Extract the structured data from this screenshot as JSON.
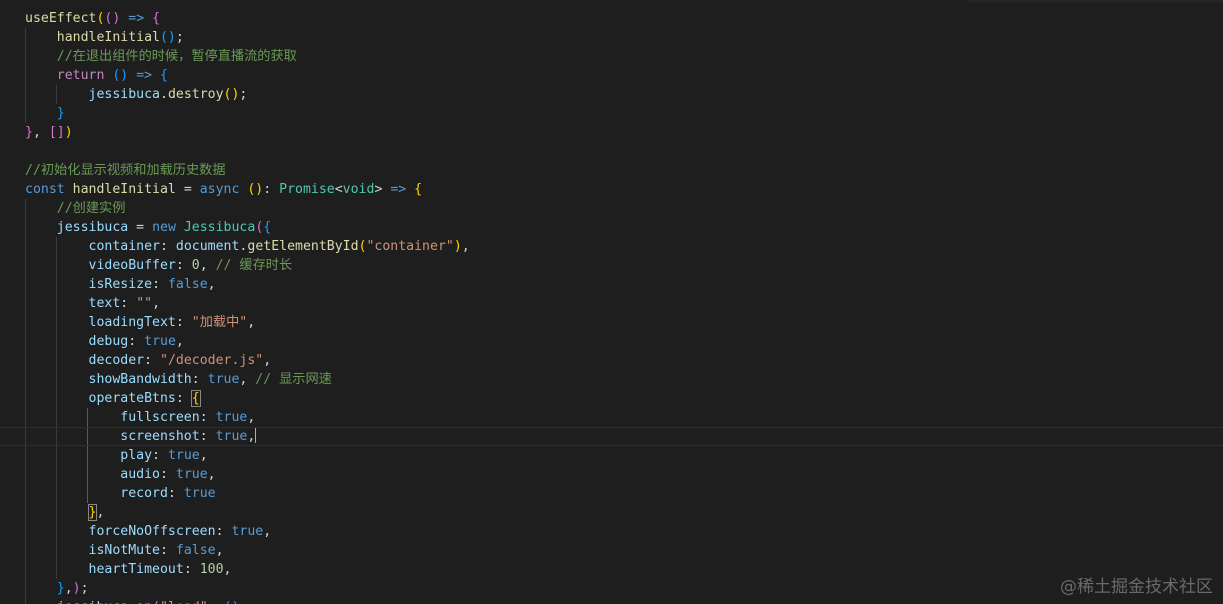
{
  "editor": {
    "lines": [
      [
        [
          "f",
          "useEffect"
        ],
        [
          "b1",
          "("
        ],
        [
          "b2",
          "()"
        ],
        [
          "p",
          " "
        ],
        [
          "k",
          "=>"
        ],
        [
          "p",
          " "
        ],
        [
          "b2",
          "{"
        ]
      ],
      [
        [
          "p",
          "    "
        ],
        [
          "f",
          "handleInitial"
        ],
        [
          "b3",
          "()"
        ],
        [
          "p",
          ";"
        ]
      ],
      [
        [
          "p",
          "    "
        ],
        [
          "m",
          "//在退出组件的时候，暂停直播流的获取"
        ]
      ],
      [
        [
          "p",
          "    "
        ],
        [
          "c",
          "return"
        ],
        [
          "p",
          " "
        ],
        [
          "b3",
          "()"
        ],
        [
          "p",
          " "
        ],
        [
          "k",
          "=>"
        ],
        [
          "p",
          " "
        ],
        [
          "b3",
          "{"
        ]
      ],
      [
        [
          "p",
          "        "
        ],
        [
          "v",
          "jessibuca"
        ],
        [
          "p",
          "."
        ],
        [
          "f",
          "destroy"
        ],
        [
          "b1",
          "()"
        ],
        [
          "p",
          ";"
        ]
      ],
      [
        [
          "p",
          "    "
        ],
        [
          "b3",
          "}"
        ]
      ],
      [
        [
          "b2",
          "}"
        ],
        [
          "p",
          ", "
        ],
        [
          "b2",
          "[]"
        ],
        [
          "b1",
          ")"
        ]
      ],
      [],
      [
        [
          "m",
          "//初始化显示视频和加载历史数据"
        ]
      ],
      [
        [
          "k",
          "const"
        ],
        [
          "p",
          " "
        ],
        [
          "f",
          "handleInitial"
        ],
        [
          "p",
          " = "
        ],
        [
          "k",
          "async"
        ],
        [
          "p",
          " "
        ],
        [
          "b1",
          "()"
        ],
        [
          "p",
          ": "
        ],
        [
          "t",
          "Promise"
        ],
        [
          "p",
          "<"
        ],
        [
          "t",
          "void"
        ],
        [
          "p",
          "> "
        ],
        [
          "k",
          "=>"
        ],
        [
          "p",
          " "
        ],
        [
          "b1",
          "{"
        ]
      ],
      [
        [
          "p",
          "    "
        ],
        [
          "m",
          "//创建实例"
        ]
      ],
      [
        [
          "p",
          "    "
        ],
        [
          "v",
          "jessibuca"
        ],
        [
          "p",
          " = "
        ],
        [
          "k",
          "new"
        ],
        [
          "p",
          " "
        ],
        [
          "t",
          "Jessibuca"
        ],
        [
          "b2",
          "("
        ],
        [
          "b3",
          "{"
        ]
      ],
      [
        [
          "p",
          "        "
        ],
        [
          "v",
          "container"
        ],
        [
          "p",
          ": "
        ],
        [
          "v",
          "document"
        ],
        [
          "p",
          "."
        ],
        [
          "f",
          "getElementById"
        ],
        [
          "b1",
          "("
        ],
        [
          "s",
          "\"container\""
        ],
        [
          "b1",
          ")"
        ],
        [
          "p",
          ","
        ]
      ],
      [
        [
          "p",
          "        "
        ],
        [
          "v",
          "videoBuffer"
        ],
        [
          "p",
          ": "
        ],
        [
          "n",
          "0"
        ],
        [
          "p",
          ", "
        ],
        [
          "m",
          "// 缓存时长"
        ]
      ],
      [
        [
          "p",
          "        "
        ],
        [
          "v",
          "isResize"
        ],
        [
          "p",
          ": "
        ],
        [
          "k",
          "false"
        ],
        [
          "p",
          ","
        ]
      ],
      [
        [
          "p",
          "        "
        ],
        [
          "v",
          "text"
        ],
        [
          "p",
          ": "
        ],
        [
          "s",
          "\"\""
        ],
        [
          "p",
          ","
        ]
      ],
      [
        [
          "p",
          "        "
        ],
        [
          "v",
          "loadingText"
        ],
        [
          "p",
          ": "
        ],
        [
          "s",
          "\"加载中\""
        ],
        [
          "p",
          ","
        ]
      ],
      [
        [
          "p",
          "        "
        ],
        [
          "v",
          "debug"
        ],
        [
          "p",
          ": "
        ],
        [
          "k",
          "true"
        ],
        [
          "p",
          ","
        ]
      ],
      [
        [
          "p",
          "        "
        ],
        [
          "v",
          "decoder"
        ],
        [
          "p",
          ": "
        ],
        [
          "s",
          "\"/decoder.js\""
        ],
        [
          "p",
          ","
        ]
      ],
      [
        [
          "p",
          "        "
        ],
        [
          "v",
          "showBandwidth"
        ],
        [
          "p",
          ": "
        ],
        [
          "k",
          "true"
        ],
        [
          "p",
          ", "
        ],
        [
          "m",
          "// 显示网速"
        ]
      ],
      [
        [
          "p",
          "        "
        ],
        [
          "v",
          "operateBtns"
        ],
        [
          "p",
          ": "
        ],
        [
          "b1 bm",
          "{"
        ]
      ],
      [
        [
          "p",
          "            "
        ],
        [
          "v",
          "fullscreen"
        ],
        [
          "p",
          ": "
        ],
        [
          "k",
          "true"
        ],
        [
          "p",
          ","
        ]
      ],
      [
        [
          "p",
          "            "
        ],
        [
          "v",
          "screenshot"
        ],
        [
          "p",
          ": "
        ],
        [
          "k",
          "true"
        ],
        [
          "p",
          ","
        ],
        [
          "cursor",
          ""
        ]
      ],
      [
        [
          "p",
          "            "
        ],
        [
          "v",
          "play"
        ],
        [
          "p",
          ": "
        ],
        [
          "k",
          "true"
        ],
        [
          "p",
          ","
        ]
      ],
      [
        [
          "p",
          "            "
        ],
        [
          "v",
          "audio"
        ],
        [
          "p",
          ": "
        ],
        [
          "k",
          "true"
        ],
        [
          "p",
          ","
        ]
      ],
      [
        [
          "p",
          "            "
        ],
        [
          "v",
          "record"
        ],
        [
          "p",
          ": "
        ],
        [
          "k",
          "true"
        ]
      ],
      [
        [
          "p",
          "        "
        ],
        [
          "b1 bm",
          "}"
        ],
        [
          "p",
          ","
        ]
      ],
      [
        [
          "p",
          "        "
        ],
        [
          "v",
          "forceNoOffscreen"
        ],
        [
          "p",
          ": "
        ],
        [
          "k",
          "true"
        ],
        [
          "p",
          ","
        ]
      ],
      [
        [
          "p",
          "        "
        ],
        [
          "v",
          "isNotMute"
        ],
        [
          "p",
          ": "
        ],
        [
          "k",
          "false"
        ],
        [
          "p",
          ","
        ]
      ],
      [
        [
          "p",
          "        "
        ],
        [
          "v",
          "heartTimeout"
        ],
        [
          "p",
          ": "
        ],
        [
          "n",
          "100"
        ],
        [
          "p",
          ","
        ]
      ],
      [
        [
          "p",
          "    "
        ],
        [
          "b3",
          "}"
        ],
        [
          "p",
          ","
        ],
        [
          "b2",
          ")"
        ],
        [
          "p",
          ";"
        ]
      ],
      [
        [
          "p",
          "    "
        ],
        [
          "v",
          "jessibuca"
        ],
        [
          "p",
          "."
        ],
        [
          "f",
          "on"
        ],
        [
          "b2",
          "("
        ],
        [
          "s",
          "\"load\""
        ],
        [
          "p",
          ", "
        ],
        [
          "b3",
          "()"
        ]
      ]
    ]
  },
  "watermark": "@稀土掘金技术社区"
}
